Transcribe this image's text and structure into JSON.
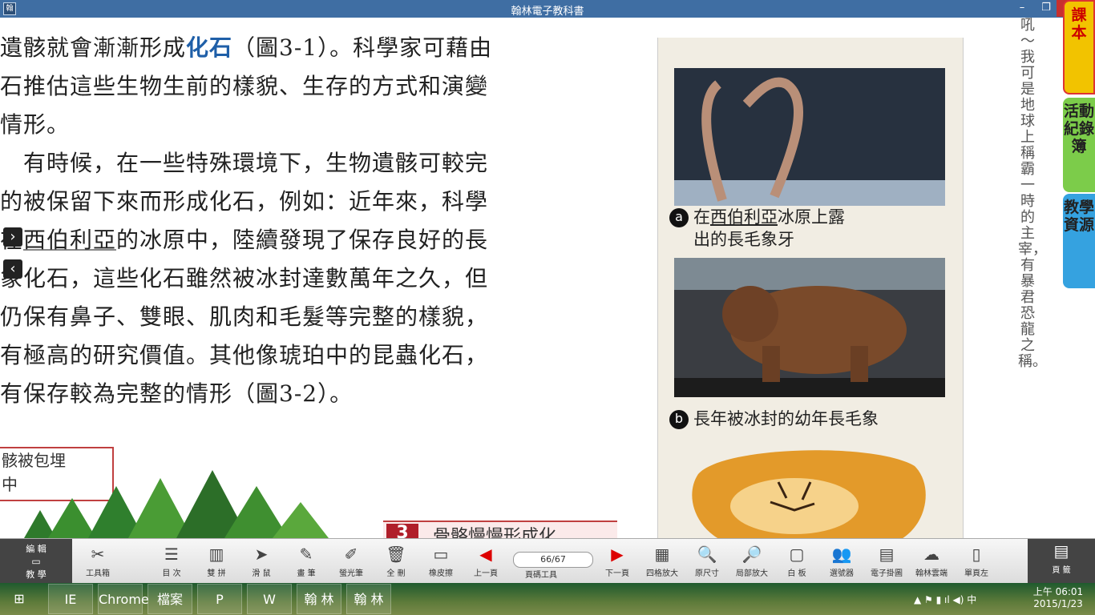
{
  "window": {
    "title": "翰林電子教科書",
    "minimize": "–",
    "maximize": "❐",
    "close": "✕"
  },
  "body_lines": [
    {
      "pre": "遺骸就會漸漸形成",
      "kw": "化石",
      "post": "（圖3-1）。科學家可藉由"
    },
    {
      "pre": "石推估這些生物生前的樣貌、生存的方式和演變",
      "kw": "",
      "post": ""
    },
    {
      "pre": "情形。",
      "kw": "",
      "post": ""
    },
    {
      "pre": "　有時候，在一些特殊環境下，生物遺骸可較完",
      "kw": "",
      "post": ""
    },
    {
      "pre": "的被保留下來而形成化石，例如：近年來，科學",
      "kw": "",
      "post": ""
    },
    {
      "pre": "在",
      "ul": "西伯利亞",
      "post": "的冰原中，陸續發現了保存良好的長"
    },
    {
      "pre": "象化石，這些化石雖然被冰封達數萬年之久，但",
      "kw": "",
      "post": ""
    },
    {
      "pre": "仍保有鼻子、雙眼、肌肉和毛髮等完整的樣貌，",
      "kw": "",
      "post": ""
    },
    {
      "pre": "有極高的研究價值。其他像琥珀中的昆蟲化石，",
      "kw": "",
      "post": ""
    },
    {
      "pre": "有保存較為完整的情形（圖3-2）。",
      "kw": "",
      "post": ""
    }
  ],
  "caption_box": [
    "骸被包埋",
    "中"
  ],
  "figure3": {
    "num": "3",
    "label": "骨骼慢慢形成化"
  },
  "figures": {
    "a": {
      "badge": "a",
      "line1_pre": "在",
      "line1_ul": "西伯利亞",
      "line1_post": "冰原上露",
      "line2": "出的長毛象牙"
    },
    "b": {
      "badge": "b",
      "text": "長年被冰封的幼年長毛象"
    }
  },
  "vertical_note": "吼～我可是地球上稱霸一時的主宰，有暴君恐龍之稱。",
  "side_tabs": {
    "textbook": "課本",
    "activity": "活動紀錄簿",
    "resources": "教學資源"
  },
  "toolbar": {
    "edit": {
      "top": "編 輯",
      "bottom": "教 學"
    },
    "toolbox": "工具箱",
    "items": [
      {
        "name": "toc",
        "label": "目 次",
        "icon": "☰"
      },
      {
        "name": "double",
        "label": "雙 拼",
        "icon": "▥"
      },
      {
        "name": "mouse",
        "label": "滑 鼠",
        "icon": "➤"
      },
      {
        "name": "pen",
        "label": "畫 筆",
        "icon": "✎"
      },
      {
        "name": "highlighter",
        "label": "螢光筆",
        "icon": "✐"
      },
      {
        "name": "clear",
        "label": "全 刪",
        "icon": "🗑"
      },
      {
        "name": "eraser",
        "label": "橡皮擦",
        "icon": "▭"
      },
      {
        "name": "prev",
        "label": "上一頁",
        "icon": "◀"
      }
    ],
    "page_input": "66/67",
    "page_tools": "頁碼工具",
    "items2": [
      {
        "name": "next",
        "label": "下一頁",
        "icon": "▶"
      },
      {
        "name": "zoom4",
        "label": "四格放大",
        "icon": "▦"
      },
      {
        "name": "orig",
        "label": "原尺寸",
        "icon": "🔍"
      },
      {
        "name": "partzoom",
        "label": "局部放大",
        "icon": "🔎"
      },
      {
        "name": "whiteboard",
        "label": "白 板",
        "icon": "▢"
      },
      {
        "name": "picker",
        "label": "選號器",
        "icon": "👥"
      },
      {
        "name": "hangmap",
        "label": "電子掛圖",
        "icon": "▤"
      },
      {
        "name": "cloud",
        "label": "翰林雲端",
        "icon": "☁"
      },
      {
        "name": "singleleft",
        "label": "單頁左",
        "icon": "▯"
      }
    ],
    "single": "頁 籤"
  },
  "taskbar": {
    "apps": [
      "IE",
      "Chrome",
      "檔案",
      "P",
      "W",
      "翰 林",
      "翰 林"
    ],
    "tray_icons": "▲ ⚑ ▮ ıl ◀) 中",
    "time": "上午 06:01",
    "date": "2015/1/23"
  }
}
